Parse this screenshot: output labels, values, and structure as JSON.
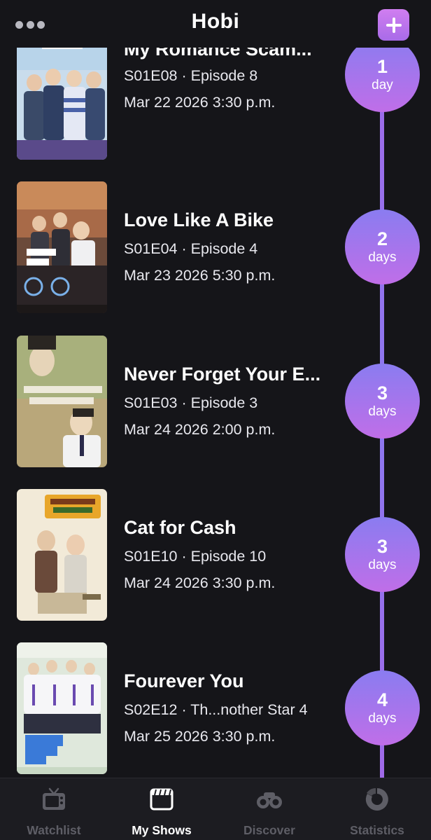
{
  "header": {
    "title": "Hobi",
    "more_icon": "ellipsis-icon",
    "add_icon": "plus-icon"
  },
  "colors": {
    "accent": "#b56eea",
    "badge_top": "#8a7cf0",
    "badge_bottom": "#c06ee8",
    "background": "#151519",
    "inactive": "#5e5e66"
  },
  "shows": [
    {
      "title": "My Romance Scam...",
      "episode": "S01E08 · Episode 8",
      "airtime": "Mar 22 2026 3:30 p.m.",
      "countdown_num": "1",
      "countdown_unit": "day"
    },
    {
      "title": "Love Like A Bike",
      "episode": "S01E04 · Episode 4",
      "airtime": "Mar 23 2026 5:30 p.m.",
      "countdown_num": "2",
      "countdown_unit": "days"
    },
    {
      "title": "Never Forget Your E...",
      "episode": "S01E03 · Episode 3",
      "airtime": "Mar 24 2026 2:00 p.m.",
      "countdown_num": "3",
      "countdown_unit": "days"
    },
    {
      "title": "Cat for Cash",
      "episode": "S01E10 · Episode 10",
      "airtime": "Mar 24 2026 3:30 p.m.",
      "countdown_num": "3",
      "countdown_unit": "days"
    },
    {
      "title": "Fourever You",
      "episode": "S02E12 · Th...nother Star 4",
      "airtime": "Mar 25 2026 3:30 p.m.",
      "countdown_num": "4",
      "countdown_unit": "days"
    }
  ],
  "tabs": [
    {
      "label": "Watchlist",
      "icon": "tv-icon",
      "active": false
    },
    {
      "label": "My Shows",
      "icon": "clapperboard-icon",
      "active": true
    },
    {
      "label": "Discover",
      "icon": "binoculars-icon",
      "active": false
    },
    {
      "label": "Statistics",
      "icon": "pie-chart-icon",
      "active": false
    }
  ]
}
